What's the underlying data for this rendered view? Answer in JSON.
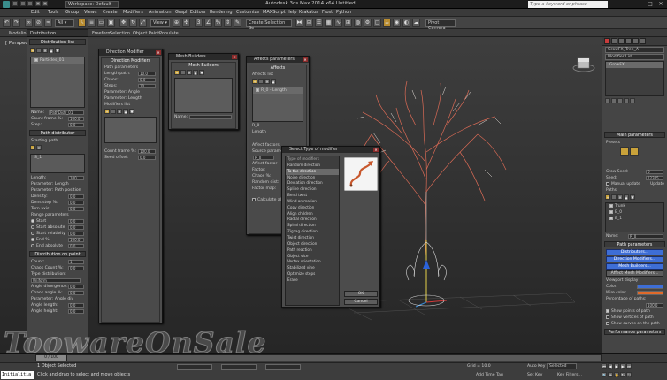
{
  "titlebar": {
    "workspace": "Workspace: Default",
    "title": "Autodesk 3ds Max 2014 x64   Untitled",
    "search_placeholder": "Type a keyword or phrase"
  },
  "menubar": [
    "Edit",
    "Tools",
    "Group",
    "Views",
    "Create",
    "Modifiers",
    "Animation",
    "Graph Editors",
    "Rendering",
    "Customize",
    "MAXScript",
    "Help",
    "Krakatoa",
    "Frost",
    "Python"
  ],
  "toolbar": {
    "selection_set": "Create Selection Se",
    "pivot_cam": "Pivot Camera"
  },
  "ribbon_tabs": [
    "Modeling",
    "Freeform",
    "Selection",
    "Object Paint",
    "Populate"
  ],
  "viewport": {
    "label": "[ Perspective ]"
  },
  "colors": {
    "accent_blue": "#3e6ed6",
    "accent_orange": "#e06a2a",
    "tree_red": "#e0705a",
    "tree_white": "#e6e0dc"
  },
  "left_panel": {
    "header": "Distribution",
    "title": "Distribution list",
    "list_item": "Particles_01",
    "name_label": "Name:",
    "name_value": "PathDistr_01",
    "count_label": "Count frame %:",
    "count_value": "100.0",
    "step_label": "Step:",
    "step_value": "0.0",
    "path_section": "Path distributor",
    "starting_path": "Starting path",
    "path_item": "S_1",
    "length_label": "Length:",
    "length_value": "100",
    "param_length": "Parameter: Length",
    "param_path_pos": "Parameter: Path position",
    "density_label": "Density:",
    "density_value": "0.0",
    "dens_step_label": "Dens step %:",
    "dens_step_value": "0.0",
    "turn_axis": "Turn axis:",
    "turn_axis_value": "0.0",
    "range_param": "Range parameters",
    "start": "Start",
    "start_value": "0.0",
    "start_absolute": "Start absolute",
    "start_value2": "0.0",
    "start_relativity": "Start relativity",
    "start_value3": "0.0",
    "end": "End %:",
    "end_value": "100.0",
    "end_absolute": "End absolute",
    "end_value2": "0.0",
    "dist_point": "Distribution on point",
    "count": "Count:",
    "count_v": "1",
    "chaos_count": "Chaos Count %:",
    "chaos_count_v": "0.0",
    "type_dist": "Type distribution:",
    "type_dist_v": "Uniform",
    "angle_divergence": "Angle divergence:",
    "angle_divergence_v": "0.0",
    "chaos_angle": "Chaos angle %:",
    "chaos_angle_v": "0.0",
    "param_angle_div": "Parameter: Angle div",
    "angle_length": "Angle length:",
    "angle_length_v": "0.0",
    "angle_height": "Angle height:",
    "angle_height_v": "0.0"
  },
  "dialog_direction": {
    "caption": "Direction Modifier",
    "title": "Direction Modifiers",
    "param_label": "Path parameters",
    "length": "Length path:",
    "length_v": "10.0",
    "chaos": "Chaos:",
    "chaos_v": "0.0",
    "steps": "Steps:",
    "steps_v": "10",
    "param_angle": "Parameter: Angle",
    "param_length": "Parameter: Length",
    "modifiers_list": "Modifiers list",
    "count_frame": "Count frame %:",
    "count_frame_v": "100.0",
    "seed_offset": "Seed offset:",
    "seed_offset_v": "0.0"
  },
  "dialog_mesh": {
    "caption": "Mesh Builders",
    "title": "Mesh Builders",
    "name": "Name:"
  },
  "dialog_affects": {
    "caption": "Affects parameters",
    "title": "Affects",
    "subtitle": "Affects list",
    "item": "R_0 - Length",
    "length": "Length",
    "affect_factors": "Affect factors",
    "source_param": "Source parameter:",
    "source_v": "R_0",
    "affect_factor": "Affect factor",
    "factor": "Factor:",
    "factor_v": "0.0",
    "chaos": "Chaos %:",
    "chaos_v": "0.0",
    "random_dist": "Random dist:",
    "random_dist_v": "0.0",
    "factor_map": "Factor map:",
    "calc_all": "Calculate all factors"
  },
  "dialog_select_modifier": {
    "caption": "Select Type of modifier",
    "list_title": "Type of modifiers",
    "items": [
      "Random direction",
      "To the direction",
      "Noise direction",
      "Deviation direction",
      "Spline direction",
      "Bend twist",
      "Wind animation",
      "Copy direction",
      "Align children",
      "Radial direction",
      "Spiral direction",
      "Zigzag direction",
      "Twist direction",
      "Object direction",
      "Path reaction",
      "Object vice",
      "Vertex orientation",
      "Stabilized vine",
      "Optimize steps",
      "Erase"
    ],
    "selected_index": 1,
    "ok": "OK",
    "cancel": "Cancel"
  },
  "right_panel": {
    "object_name": "GrowFX_Tree_A",
    "modifier_list": "Modifier List",
    "stack_item": "GrowFX",
    "main_params": "Main parameters",
    "presets": "Presets",
    "grow_seed": "Grow Seed:",
    "grow_seed_v": "0",
    "seed": "Seed:",
    "seed_v": "12345",
    "manual_update": "Manual update",
    "update": "Update",
    "paths": "Paths",
    "path_items": [
      "Trunk",
      "B_0",
      "B_1"
    ],
    "name_label": "Name:",
    "name_value": "R_0",
    "path_params": "Path parameters",
    "btn_distributors": "Distributors...",
    "btn_direction": "Direction Modifiers...",
    "btn_mesh": "Mesh Builders...",
    "btn_affect": "Affect Mesh Modifiers...",
    "viewport_display": "Viewport display",
    "color_label": "Color:",
    "wire_color": "Wire color:",
    "perc_paths": "Percentage of paths:",
    "perc_v": "100.0",
    "show_points": "Show points of path",
    "show_vertices": "Show vertices of path",
    "show_curves": "Show curves on the path",
    "performance": "Performance parameters"
  },
  "timeline": {
    "frame": "0 / 100"
  },
  "status": {
    "maxscript": "Initialitia",
    "line1": "1 Object Selected",
    "line2": "Click and drag to select and move objects",
    "selected": "Selected",
    "add_time_tag": "Add Time Tag",
    "autokey": "Auto Key",
    "setkey": "Set Key",
    "key_filters": "Key Filters...",
    "grid": "Grid = 10.0"
  },
  "watermark": "ToowareOnSale"
}
